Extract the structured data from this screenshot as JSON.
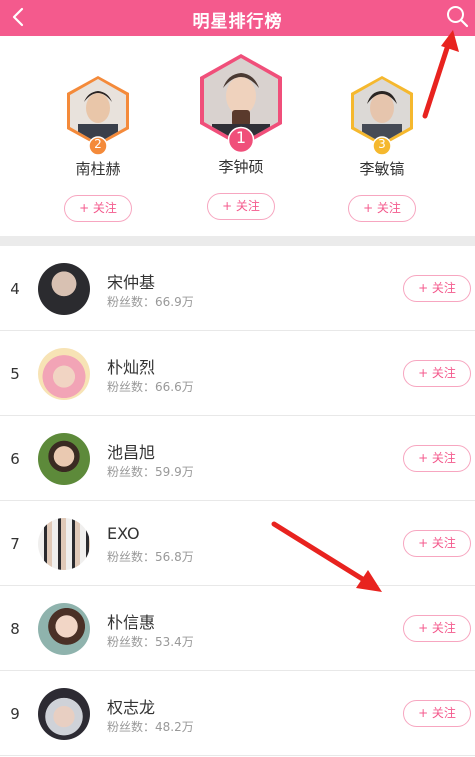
{
  "header": {
    "title": "明星排行榜"
  },
  "podium": [
    {
      "rank_badge": "2",
      "name": "南柱赫",
      "follow_label": "+ 关注",
      "color": "#f48a3a"
    },
    {
      "rank_badge": "1",
      "name": "李钟硕",
      "follow_label": "+ 关注",
      "color": "#f04f7a"
    },
    {
      "rank_badge": "3",
      "name": "李敏镐",
      "follow_label": "+ 关注",
      "color": "#f5b82e"
    }
  ],
  "list": [
    {
      "rank": "4",
      "name": "宋仲基",
      "fans": "粉丝数：66.9万",
      "follow_label": "+ 关注"
    },
    {
      "rank": "5",
      "name": "朴灿烈",
      "fans": "粉丝数：66.6万",
      "follow_label": "+ 关注"
    },
    {
      "rank": "6",
      "name": "池昌旭",
      "fans": "粉丝数：59.9万",
      "follow_label": "+ 关注"
    },
    {
      "rank": "7",
      "name": "EXO",
      "fans": "粉丝数：56.8万",
      "follow_label": "+ 关注"
    },
    {
      "rank": "8",
      "name": "朴信惠",
      "fans": "粉丝数：53.4万",
      "follow_label": "+ 关注"
    },
    {
      "rank": "9",
      "name": "权志龙",
      "fans": "粉丝数：48.2万",
      "follow_label": "+ 关注"
    }
  ],
  "colors": {
    "brand": "#f45a8d",
    "annotation_arrow": "#e8231f"
  },
  "icons": {
    "back": "chevron-left-icon",
    "search": "search-icon"
  }
}
